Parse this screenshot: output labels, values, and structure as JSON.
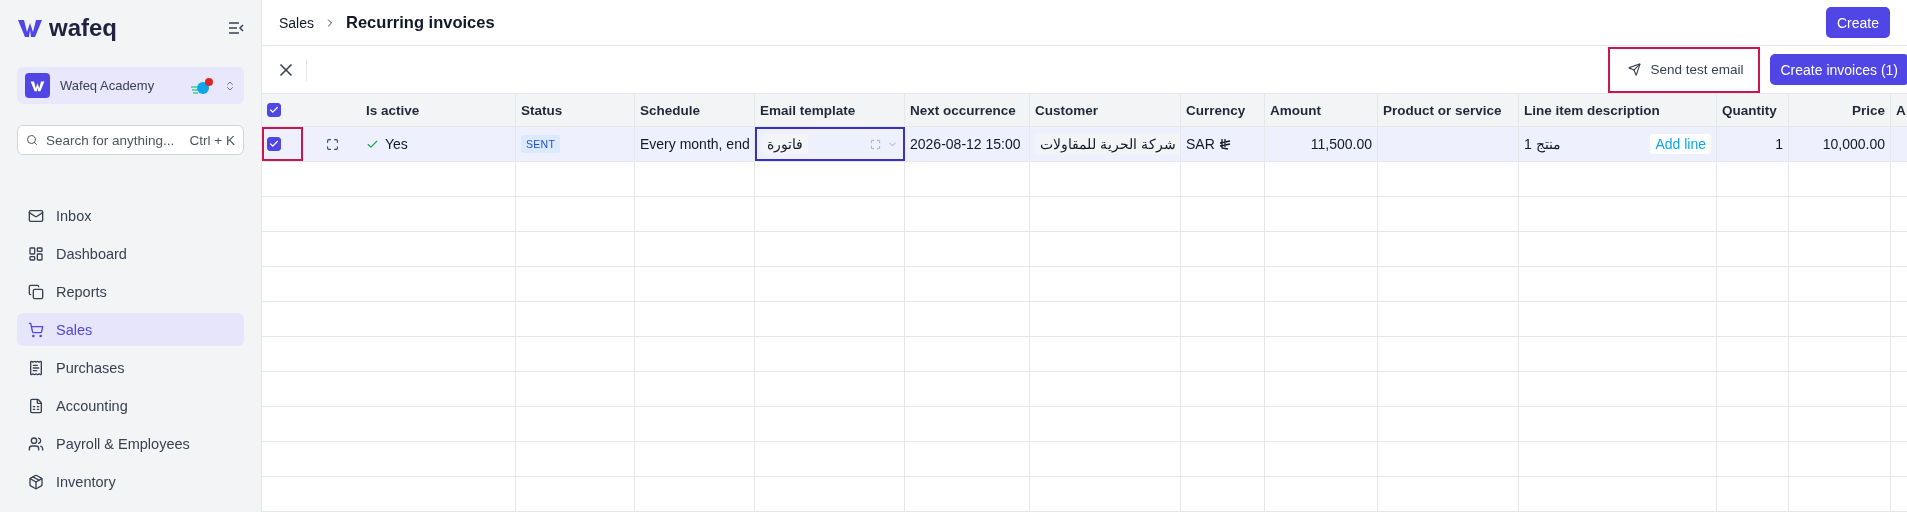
{
  "sidebar": {
    "brand": "wafeq",
    "org": {
      "name": "Wafeq Academy",
      "notification": true
    },
    "search": {
      "placeholder": "Search for anything...",
      "shortcut": "Ctrl + K"
    },
    "items": [
      {
        "label": "Inbox",
        "selected": false
      },
      {
        "label": "Dashboard",
        "selected": false
      },
      {
        "label": "Reports",
        "selected": false
      },
      {
        "label": "Sales",
        "selected": true
      },
      {
        "label": "Purchases",
        "selected": false
      },
      {
        "label": "Accounting",
        "selected": false
      },
      {
        "label": "Payroll & Employees",
        "selected": false
      },
      {
        "label": "Inventory",
        "selected": false
      }
    ]
  },
  "header": {
    "breadcrumb": "Sales",
    "title": "Recurring invoices",
    "create": "Create"
  },
  "toolbar": {
    "send_test_email": {
      "label": "Send test email",
      "highlighted": true
    },
    "create_invoices": "Create invoices (1)"
  },
  "table": {
    "all_checked": true,
    "columns": [
      "Is active",
      "Status",
      "Schedule",
      "Email template",
      "Next occurrence",
      "Customer",
      "Currency",
      "Amount",
      "Product or service",
      "Line item description",
      "Quantity",
      "Price",
      "A"
    ],
    "rows": [
      {
        "selected": true,
        "checked": true,
        "highlighted": true,
        "is_active": "Yes",
        "status": "SENT",
        "schedule": "Every month, end",
        "email_template": "فاتورة",
        "email_template_focused": true,
        "next_occurrence": "2026-08-12 15:00",
        "customer": "شركة الحرية للمقاولات",
        "currency": "SAR",
        "amount": "11,500.00",
        "line_item_description": "منتج 1",
        "add_line": "Add line",
        "quantity": "1",
        "price": "10,000.00"
      }
    ]
  }
}
